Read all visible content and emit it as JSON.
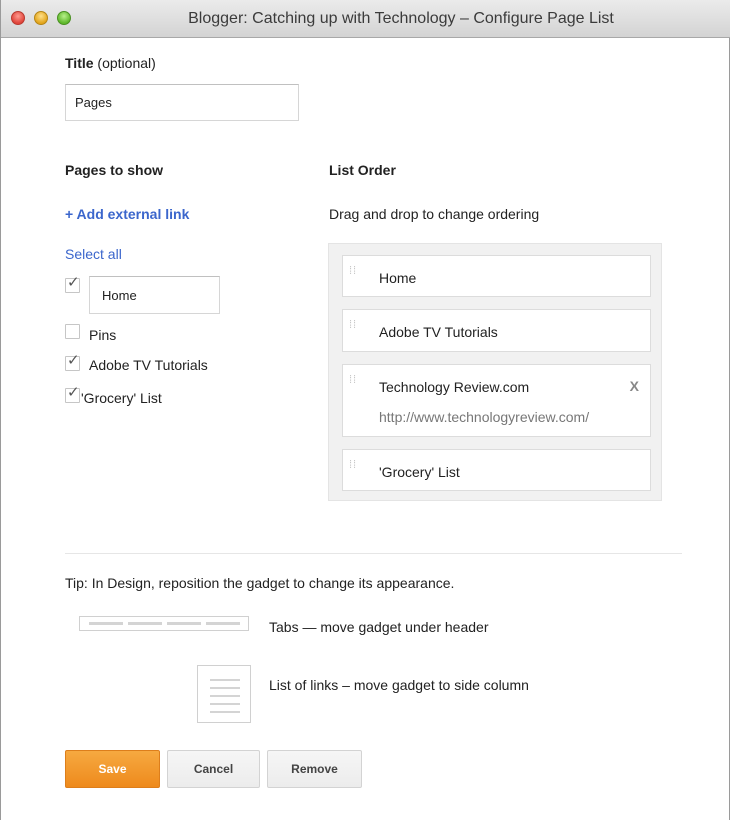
{
  "window": {
    "title": "Blogger: Catching up with Technology – Configure Page List"
  },
  "title_field": {
    "label": "Title",
    "label_suffix": "(optional)",
    "value": "Pages"
  },
  "pages_to_show": {
    "heading": "Pages to show",
    "add_external_link": "+ Add external link",
    "select_all": "Select all",
    "items": [
      {
        "label": "Home",
        "checked": true,
        "editable": true
      },
      {
        "label": "Pins",
        "checked": false
      },
      {
        "label": "Adobe TV Tutorials",
        "checked": true
      },
      {
        "label": "'Grocery' List",
        "checked": true
      }
    ]
  },
  "list_order": {
    "heading": "List Order",
    "hint": "Drag and drop to change ordering",
    "items": [
      {
        "label": "Home"
      },
      {
        "label": "Adobe TV Tutorials"
      },
      {
        "label": "Technology Review.com",
        "url": "http://www.technologyreview.com/",
        "remove_label": "X"
      },
      {
        "label": "'Grocery' List"
      }
    ]
  },
  "tip": {
    "text": "Tip: In Design, reposition the gadget to change its appearance.",
    "tabs_caption": "Tabs — move gadget under header",
    "list_caption": "List of links – move gadget to side column"
  },
  "buttons": {
    "save": "Save",
    "cancel": "Cancel",
    "remove": "Remove"
  },
  "colors": {
    "link": "#3b66cc",
    "save_button": "#f39c2c"
  },
  "icons": {
    "checkbox_checked": "checkmark-icon",
    "drag_handle": "drag-handle-icon",
    "remove": "close-icon"
  }
}
